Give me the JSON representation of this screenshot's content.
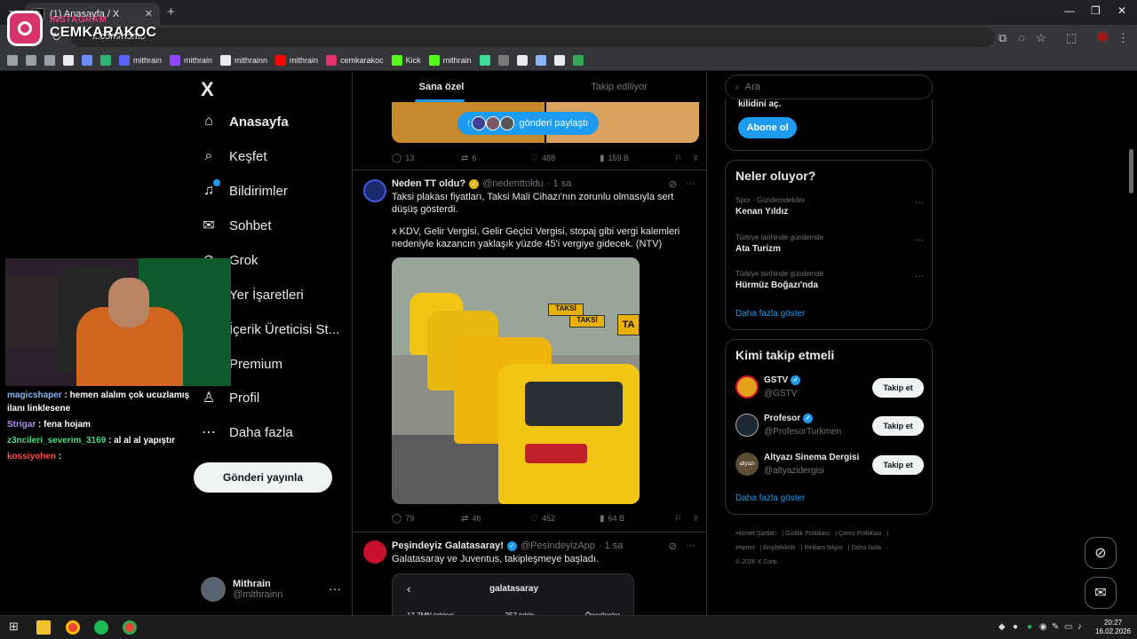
{
  "browser": {
    "tab_title": "(1) Anasayfa / X",
    "tab_favicon": "x-logo",
    "url": "x.com/home",
    "new_tab_icon": "+",
    "bookmarks": [
      {
        "label": "",
        "icon": "apps-icon",
        "color": "#9aa0a6"
      },
      {
        "label": "",
        "icon": "folder-icon",
        "color": "#9aa0a6"
      },
      {
        "label": "",
        "icon": "folder-icon",
        "color": "#9aa0a6"
      },
      {
        "label": "",
        "icon": "diamond-icon",
        "color": "#e8eaed"
      },
      {
        "label": "",
        "icon": "swirl-icon",
        "color": "#6c8cff"
      },
      {
        "label": "",
        "icon": "square-icon",
        "color": "#2bb673"
      },
      {
        "label": "mithrain",
        "icon": "discord-icon",
        "color": "#5865f2"
      },
      {
        "label": "mithrain",
        "icon": "twitch-icon",
        "color": "#9146ff"
      },
      {
        "label": "mithrainn",
        "icon": "x-icon",
        "color": "#e8eaed"
      },
      {
        "label": "mithrain",
        "icon": "youtube-icon",
        "color": "#ff0000"
      },
      {
        "label": "cemkarakoc",
        "icon": "instagram-icon",
        "color": "#e1306c"
      },
      {
        "label": "Kick",
        "icon": "kick-icon",
        "color": "#53fc18"
      },
      {
        "label": "mithrain",
        "icon": "kick-icon",
        "color": "#53fc18"
      },
      {
        "label": "",
        "icon": "app-icon",
        "color": "#3ddc97"
      },
      {
        "label": "",
        "icon": "png-icon",
        "color": "#7a7a7a"
      },
      {
        "label": "",
        "icon": "circle-icon",
        "color": "#e8eaed"
      },
      {
        "label": "",
        "icon": "sparkle-icon",
        "color": "#8ab4f8"
      },
      {
        "label": "",
        "icon": "doc-icon",
        "color": "#e8eaed"
      },
      {
        "label": "",
        "icon": "map-icon",
        "color": "#34a853"
      }
    ]
  },
  "watermark": {
    "label": "INSTAGRAM",
    "name": "CEMKARAKOC"
  },
  "nav": {
    "logo": "X",
    "items": [
      {
        "label": "Anasayfa",
        "icon": "home-icon",
        "active": true
      },
      {
        "label": "Keşfet",
        "icon": "search-icon"
      },
      {
        "label": "Bildirimler",
        "icon": "bell-icon"
      },
      {
        "label": "Sohbet",
        "icon": "mail-icon"
      },
      {
        "label": "Grok",
        "icon": "grok-icon"
      },
      {
        "label": "Yer İşaretleri",
        "icon": "bookmark-icon"
      },
      {
        "label": "İçerik Üreticisi St...",
        "icon": "creator-icon"
      },
      {
        "label": "Premium",
        "icon": "premium-icon"
      },
      {
        "label": "Profil",
        "icon": "user-icon"
      },
      {
        "label": "Daha fazla",
        "icon": "more-circle-icon"
      }
    ],
    "post_button": "Gönderi yayınla",
    "account": {
      "name": "Mithrain",
      "handle": "@mithrainn",
      "more": "···"
    }
  },
  "chat": [
    {
      "user": "magicshaper",
      "color": "#8ab4f8",
      "text": " : hemen alalım çok ucuzlamış ilanı linklesene"
    },
    {
      "user": "Strigar",
      "color": "#b48cff",
      "text": " : fena hojam"
    },
    {
      "user": "z3ncileri_severim_3169",
      "color": "#4ade80",
      "text": " : al al al yapıştır"
    },
    {
      "user": "kossiyohen",
      "color": "#ff4d4d",
      "text": " : "
    }
  ],
  "feed": {
    "tabs": [
      {
        "label": "Sana özel",
        "active": true
      },
      {
        "label": "Takip ediliyor",
        "active": false
      }
    ],
    "share_pill": "gönderi paylaştı",
    "first_actions": {
      "replies": "13",
      "reposts": "6",
      "likes": "488",
      "views": "159 B"
    },
    "tweets": [
      {
        "name": "Neden TT oldu?",
        "handle": "@nedenttoldu",
        "time": "· 1 sa",
        "verified": "gold",
        "text1": "Taksi plakası fiyatları, Taksi Mali Cihazı'nın zorunlu olmasıyla sert düşüş gösterdi.",
        "text2": "x KDV, Gelir Vergisi, Gelir Geçici Vergisi, stopaj gibi vergi kalemleri nedeniyle kazancın yaklaşık yüzde 45'i vergiye gidecek. (NTV)",
        "image_sign_1": "TAKSİ",
        "image_sign_2": "TAKSİ",
        "image_sign_3": "TA",
        "actions": {
          "replies": "79",
          "reposts": "46",
          "likes": "452",
          "views": "64 B"
        }
      },
      {
        "name": "Peşindeyiz Galatasaray!",
        "handle": "@PesindeyizApp",
        "time": "· 1 sa",
        "verified": "blue",
        "text1": "Galatasaray ve Juventus, takipleşmeye başladı.",
        "card": {
          "title": "galatasaray",
          "stats": [
            "17,7MN takipçi",
            "257 takip",
            "Önerilenler"
          ]
        }
      }
    ]
  },
  "right": {
    "search_placeholder": "Ara",
    "premium_text": "kilidini aç.",
    "subscribe": "Abone ol",
    "trends_title": "Neler oluyor?",
    "trends": [
      {
        "category": "Spor · Gündemdekiler",
        "name": "Kenan Yıldız"
      },
      {
        "category": "Türkiye tarihinde gündemde",
        "name": "Ata Turizm"
      },
      {
        "category": "Türkiye tarihinde gündemde",
        "name": "Hürmüz Boğazı'nda"
      }
    ],
    "trends_more": "Daha fazla göster",
    "follow_title": "Kimi takip etmeli",
    "follow": [
      {
        "name": "GSTV",
        "handle": "@GSTV",
        "verified": true,
        "avatar_color": "#e3a21a"
      },
      {
        "name": "Profesor",
        "handle": "@ProfesorTurkmen",
        "verified": true,
        "avatar_color": "#1c2733"
      },
      {
        "name": "Altyazı Sinema Dergisi",
        "handle": "@altyazidergisi",
        "verified": false,
        "avatar_color": "#5b4c33",
        "avatar_text": "altyazı"
      }
    ],
    "follow_button": "Takip et",
    "follow_more": "Daha fazla göster",
    "footer": [
      "Hizmet Şartları",
      "Gizlilik Politikası",
      "Çerez Politikası",
      "Imprint",
      "Erişilebilirlik",
      "Reklam bilgisi",
      "Daha fazla ···",
      "© 2026 X Corp."
    ]
  },
  "taskbar": {
    "time": "20:27",
    "date": "16.02.2026"
  }
}
